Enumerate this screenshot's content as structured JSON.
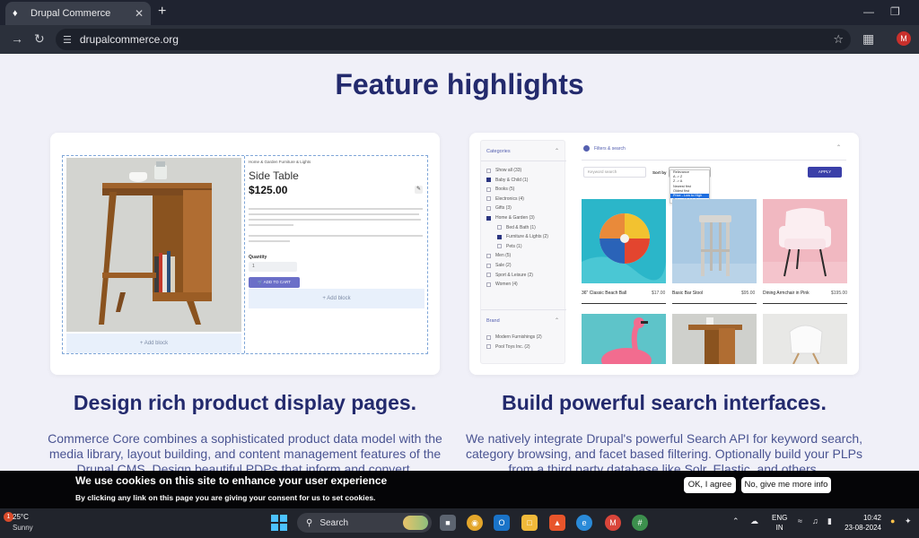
{
  "browser": {
    "tab_title": "Drupal Commerce",
    "url": "drupalcommerce.org",
    "profile_initial": "M"
  },
  "page": {
    "heading": "Feature highlights",
    "features": [
      {
        "title": "Design rich product display pages.",
        "description": "Commerce Core combines a sophisticated product data model with the media library, layout building, and content management features of the Drupal CMS. Design beautiful PDPs that inform and convert."
      },
      {
        "title": "Build powerful search interfaces.",
        "description": "We natively integrate Drupal's powerful Search API for keyword search, category browsing, and facet based filtering. Optionally build your PLPs from a third party database like Solr, Elastic, and others."
      }
    ],
    "product_preview": {
      "breadcrumb": "Home & Garden     Furniture & Lights",
      "name": "Side Table",
      "price": "$125.00",
      "quantity_label": "Quantity",
      "quantity_value": "1",
      "add_to_cart": "ADD TO CART",
      "add_block": "+ Add block"
    },
    "search_preview": {
      "categories_label": "Categories",
      "categories": [
        {
          "label": "Show all (33)",
          "checked": false,
          "sub": false
        },
        {
          "label": "Baby & Child (1)",
          "checked": true,
          "sub": false
        },
        {
          "label": "Books (5)",
          "checked": false,
          "sub": false
        },
        {
          "label": "Electronics (4)",
          "checked": false,
          "sub": false
        },
        {
          "label": "Gifts (3)",
          "checked": false,
          "sub": false
        },
        {
          "label": "Home & Garden (3)",
          "checked": true,
          "sub": false
        },
        {
          "label": "Bed & Bath (1)",
          "checked": false,
          "sub": true
        },
        {
          "label": "Furniture & Lights (2)",
          "checked": true,
          "sub": true
        },
        {
          "label": "Pets (1)",
          "checked": false,
          "sub": true
        },
        {
          "label": "Men (5)",
          "checked": false,
          "sub": false
        },
        {
          "label": "Sale (2)",
          "checked": false,
          "sub": false
        },
        {
          "label": "Sport & Leisure (2)",
          "checked": false,
          "sub": false
        },
        {
          "label": "Women (4)",
          "checked": false,
          "sub": false
        }
      ],
      "brand_label": "Brand",
      "brands": [
        {
          "label": "Modern Furnishings (2)",
          "checked": false
        },
        {
          "label": "Pool Toys Inc. (2)",
          "checked": false
        }
      ],
      "filters_label": "Filters & search",
      "keyword_placeholder": "Keyword search",
      "sort_label": "Sort by",
      "sort_options": [
        "Relevance",
        "A -> Z",
        "Z -> A",
        "Newest first",
        "Oldest first",
        "Price - Low to High",
        "Price - High to Low"
      ],
      "sort_selected_index": 5,
      "apply": "APPLY",
      "products": [
        {
          "name": "36\" Classic Beach Ball",
          "price": "$17.00"
        },
        {
          "name": "Basic Bar Stool",
          "price": "$95.00"
        },
        {
          "name": "Dining Armchair in Pink",
          "price": "$195.00"
        }
      ]
    }
  },
  "cookie_banner": {
    "title": "We use cookies on this site to enhance your user experience",
    "text": "By clicking any link on this page you are giving your consent for us to set cookies.",
    "ok_label": "OK, I agree",
    "more_label": "No, give me more info"
  },
  "taskbar": {
    "temperature": "25°C",
    "weather": "Sunny",
    "search_label": "Search",
    "lang_1": "ENG",
    "lang_2": "IN",
    "time": "10:42",
    "date": "23-08-2024"
  },
  "colors": {
    "heading": "#232a6d",
    "page_bg": "#f0f0f8",
    "accent": "#3a3fa8"
  }
}
